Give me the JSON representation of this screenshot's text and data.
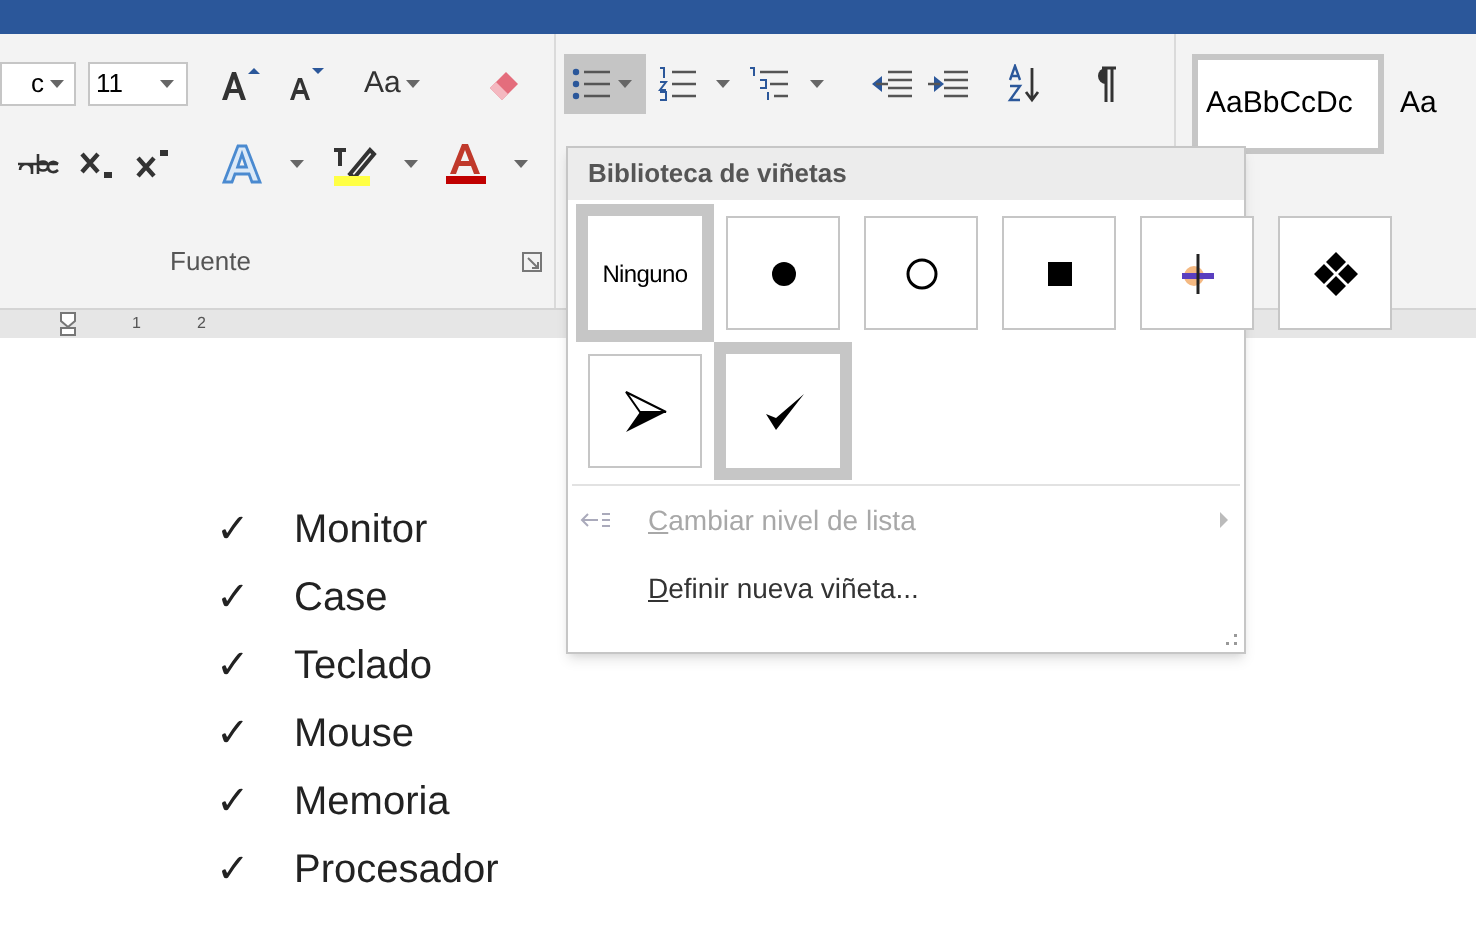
{
  "ribbon": {
    "font_name": "c",
    "font_size": "11",
    "change_case": "Aa",
    "group_label": "Fuente",
    "styles": [
      {
        "sample": "AaBbCcDc",
        "selected": true
      },
      {
        "sample": "Aa",
        "selected": false
      }
    ],
    "bullets_button": {
      "selected": true
    }
  },
  "ruler": {
    "marks": [
      "1",
      "2"
    ]
  },
  "bullet_menu": {
    "header": "Biblioteca de viñetas",
    "bullets": [
      {
        "kind": "none",
        "label": "Ninguno",
        "selected": true
      },
      {
        "kind": "dot",
        "selected": false
      },
      {
        "kind": "circle",
        "selected": false
      },
      {
        "kind": "square",
        "selected": false
      },
      {
        "kind": "picture",
        "selected": false
      },
      {
        "kind": "diamonds",
        "selected": false
      },
      {
        "kind": "arrowhead",
        "selected": false
      },
      {
        "kind": "check",
        "selected": true
      }
    ],
    "items": [
      {
        "label": "Cambiar nivel de lista",
        "disabled": true,
        "submenu": true
      },
      {
        "label": "Definir nueva viñeta...",
        "disabled": false,
        "submenu": false
      }
    ]
  },
  "document": {
    "list": [
      {
        "bullet": "✓",
        "text": "Monitor"
      },
      {
        "bullet": "✓",
        "text": "Case"
      },
      {
        "bullet": "✓",
        "text": "Teclado"
      },
      {
        "bullet": "✓",
        "text": "Mouse"
      },
      {
        "bullet": "✓",
        "text": "Memoria"
      },
      {
        "bullet": "✓",
        "text": "Procesador"
      }
    ]
  }
}
